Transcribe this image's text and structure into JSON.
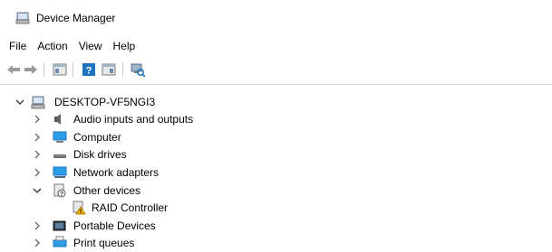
{
  "window": {
    "title": "Device Manager"
  },
  "menu": [
    "File",
    "Action",
    "View",
    "Help"
  ],
  "toolbar": {
    "buttons": [
      "back-icon",
      "forward-icon",
      "properties-icon",
      "help-icon",
      "show-hidden-icon",
      "scan-hardware-icon"
    ]
  },
  "tree": {
    "root": {
      "label": "DESKTOP-VF5NGI3",
      "expanded": true
    },
    "items": [
      {
        "label": "Audio inputs and outputs",
        "icon": "speaker-icon",
        "expanded": false
      },
      {
        "label": "Computer",
        "icon": "monitor-icon",
        "expanded": false
      },
      {
        "label": "Disk drives",
        "icon": "disk-drive-icon",
        "expanded": false
      },
      {
        "label": "Network adapters",
        "icon": "network-adapter-icon",
        "expanded": false
      },
      {
        "label": "Other devices",
        "icon": "unknown-device-icon",
        "expanded": true,
        "children": [
          {
            "label": "RAID Controller",
            "icon": "warning-device-icon"
          }
        ]
      },
      {
        "label": "Portable Devices",
        "icon": "portable-device-icon",
        "expanded": false
      },
      {
        "label": "Print queues",
        "icon": "printer-icon",
        "expanded": false
      }
    ]
  },
  "colors": {
    "accent": "#1e73be",
    "warning": "#f2b705",
    "separator": "#c8c8c8"
  }
}
